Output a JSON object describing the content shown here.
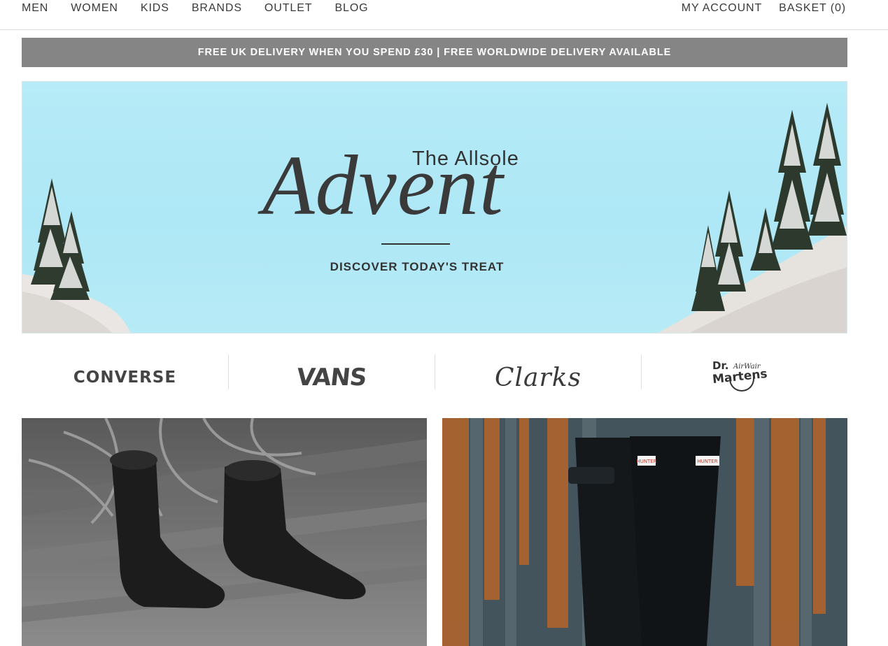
{
  "nav": {
    "left": [
      "MEN",
      "WOMEN",
      "KIDS",
      "BRANDS",
      "OUTLET",
      "BLOG"
    ],
    "account": "MY ACCOUNT",
    "basket": "BASKET (0)"
  },
  "promo": {
    "text": "FREE UK DELIVERY WHEN YOU SPEND £30 | FREE WORLDWIDE DELIVERY AVAILABLE"
  },
  "hero": {
    "eyebrow": "The Allsole",
    "title": "Advent",
    "cta": "DISCOVER TODAY'S TREAT"
  },
  "brands": {
    "converse": "CONVERSE",
    "vans": "VANS",
    "clarks": "Clarks",
    "drmartens_top": "Dr.",
    "drmartens_air": "AirWair",
    "drmartens_name": "Martens"
  },
  "boot_labels": {
    "left_boot": "HUNTER",
    "right_boot": "HUNTER"
  },
  "colors": {
    "promo_bg": "#858585",
    "hero_sky": "#b0e8f6",
    "text_dark": "#333333"
  }
}
